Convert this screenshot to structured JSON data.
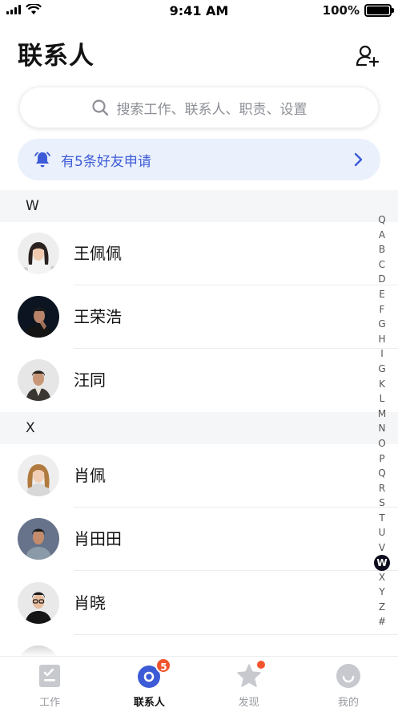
{
  "status_bar": {
    "time": "9:41 AM",
    "battery": "100%"
  },
  "header": {
    "title": "联系人"
  },
  "search": {
    "placeholder": "搜索工作、联系人、职责、设置"
  },
  "banner": {
    "text": "有5条好友申请"
  },
  "sections": [
    {
      "letter": "W",
      "contacts": [
        {
          "name": "王佩佩"
        },
        {
          "name": "王荣浩"
        },
        {
          "name": "汪同"
        }
      ]
    },
    {
      "letter": "X",
      "contacts": [
        {
          "name": "肖佩"
        },
        {
          "name": "肖田田"
        },
        {
          "name": "肖晓"
        }
      ]
    }
  ],
  "alphabet_index": [
    "Q",
    "A",
    "B",
    "C",
    "D",
    "E",
    "F",
    "G",
    "H",
    "I",
    "G",
    "K",
    "L",
    "M",
    "N",
    "O",
    "P",
    "Q",
    "R",
    "S",
    "T",
    "U",
    "V",
    "W",
    "X",
    "Y",
    "Z",
    "#"
  ],
  "alphabet_active": "W",
  "tabbar": {
    "tabs": [
      {
        "label": "工作"
      },
      {
        "label": "联系人",
        "badge": "5"
      },
      {
        "label": "发现"
      },
      {
        "label": "我的"
      }
    ],
    "active_index": 1
  },
  "colors": {
    "accent": "#3d5bd6",
    "badge": "#f2542d",
    "banner_bg": "#eaf0fc",
    "section_bg": "#f5f6f8"
  }
}
